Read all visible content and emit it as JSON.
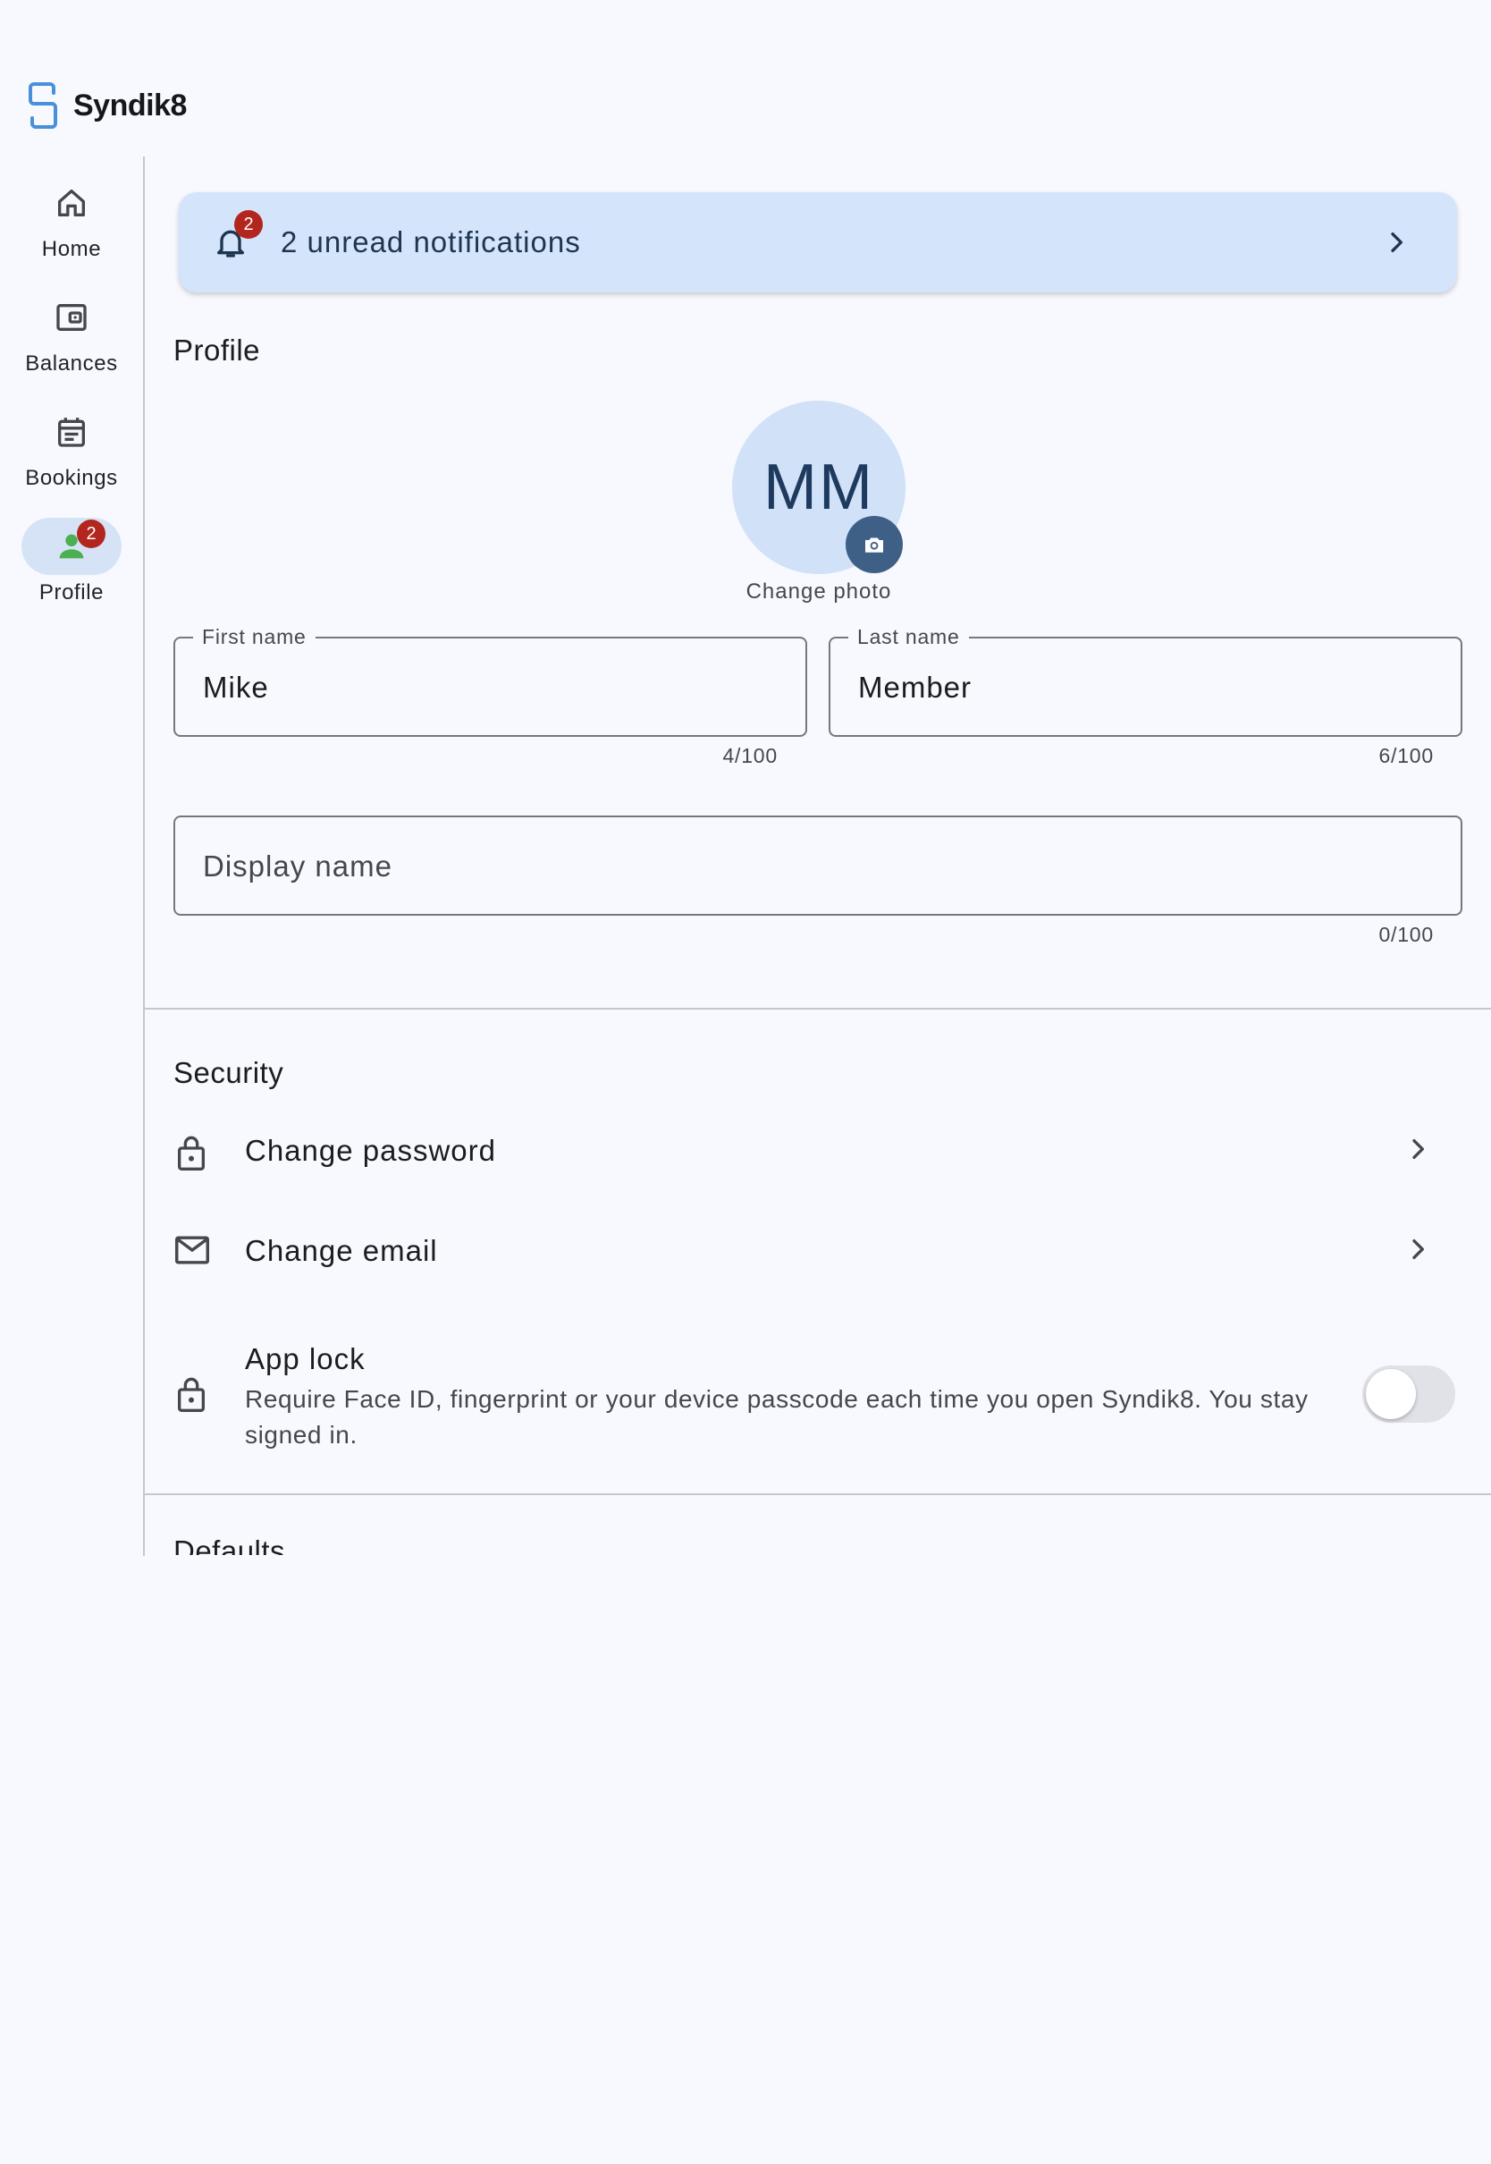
{
  "app": {
    "name": "Syndik8",
    "accent": "#4a90d9"
  },
  "nav": {
    "items": [
      {
        "label": "Home",
        "icon": "home-icon"
      },
      {
        "label": "Balances",
        "icon": "wallet-icon"
      },
      {
        "label": "Bookings",
        "icon": "calendar-icon"
      },
      {
        "label": "Profile",
        "icon": "person-icon",
        "badge": "2",
        "active": true
      }
    ]
  },
  "notifications": {
    "text": "2 unread notifications",
    "badge": "2"
  },
  "profile": {
    "section_title": "Profile",
    "avatar_initials": "MM",
    "change_photo": "Change photo",
    "first_name": {
      "label": "First name",
      "value": "Mike",
      "counter": "4/100"
    },
    "last_name": {
      "label": "Last name",
      "value": "Member",
      "counter": "6/100"
    },
    "display_name": {
      "placeholder": "Display name",
      "value": "",
      "counter": "0/100"
    }
  },
  "security": {
    "section_title": "Security",
    "change_password": "Change password",
    "change_email": "Change email",
    "app_lock": {
      "label": "App lock",
      "description": "Require Face ID, fingerprint or your device passcode each time you open Syndik8. You stay signed in.",
      "enabled": false
    }
  },
  "defaults": {
    "section_title": "Defaults"
  },
  "colors": {
    "badge": "#b3261e",
    "banner": "#d4e4fb",
    "active_nav": "#d6e3f7",
    "person_icon": "#4caf50"
  }
}
